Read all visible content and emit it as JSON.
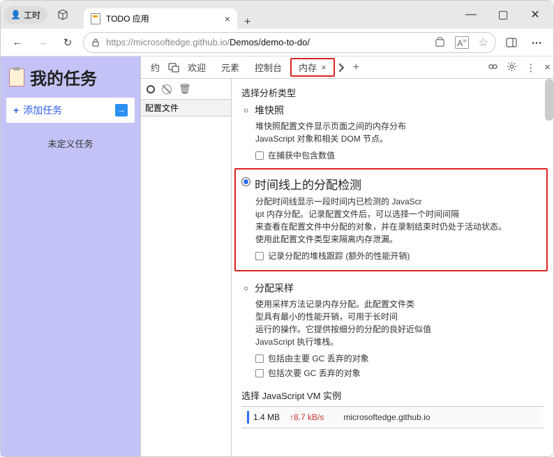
{
  "titlebar": {
    "workspace_label": "工时",
    "tab_title": "TODO 应用"
  },
  "window_buttons": {
    "minimize": "—",
    "maximize": "▢",
    "close": "✕"
  },
  "addressbar": {
    "back": "←",
    "forward": "→",
    "reload": "↻",
    "url_prefix": "https://microsoftedge.github.io/",
    "url_path": "Demos/demo-to-do/"
  },
  "sidebar": {
    "title": "我的任务",
    "add_label": "添加任务",
    "undefined_label": "未定义任务"
  },
  "devtools": {
    "tabs": {
      "t0": "约",
      "t1": "欢迎",
      "t2": "元素",
      "t3": "控制台",
      "t4_active": "内存"
    },
    "left": {
      "profiles_header": "配置文件"
    },
    "main": {
      "select_type": "选择分析类型",
      "heap": {
        "radio_label": "堆快照",
        "desc1": "堆快照配置文件显示页面之间的内存分布",
        "desc2": "JavaScript 对象和相关 DOM 节点。",
        "cb1": "在捕获中包含数值"
      },
      "timeline": {
        "radio_label": "时间线上的分配检测",
        "desc1": "分配时间线显示一段时间内已检测的 JavaScr",
        "desc2": "ipt 内存分配。记录配置文件后，可以选择一个时间间隔",
        "desc3": "来查看在配置文件中分配的对象，并在录制结束时仍处于活动状态。",
        "desc4": "使用此配置文件类型来隔离内存泄漏。",
        "cb1": "记录分配的堆栈跟踪 (额外的性能开销)"
      },
      "sampling": {
        "radio_label": "分配采样",
        "desc1": "使用采样方法记录内存分配。此配置文件类",
        "desc2": "型具有最小的性能开销，可用于长时间",
        "desc3": "运行的操作。它提供按细分的分配的良好近似值",
        "desc4": "JavaScript 执行堆栈。",
        "cb1": "包括由主要 GC 丢弃的对象",
        "cb2": "包括次要 GC 丢弃的对象"
      },
      "vm": {
        "title": "选择 JavaScript VM 实例",
        "size": "1.4 MB",
        "rate": "↑8.7 kB/s",
        "name": "microsoftedge.github.io"
      }
    }
  }
}
